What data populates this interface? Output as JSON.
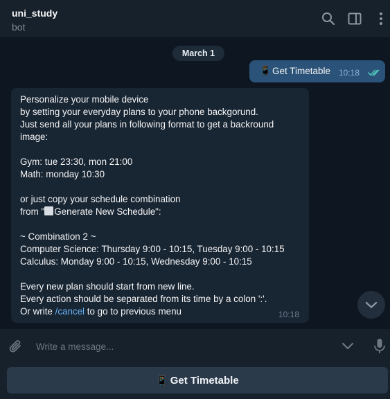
{
  "header": {
    "title": "uni_study",
    "status": "bot",
    "icons": [
      "search-icon",
      "sidebar-toggle-icon",
      "more-vertical-icon"
    ]
  },
  "chat": {
    "date": "March 1",
    "outgoing": {
      "emoji": "📱",
      "text": "Get Timetable",
      "time": "10:18",
      "status_icon": "double-check-icon"
    },
    "incoming": {
      "lines": {
        "l1": "Personalize your mobile device",
        "l2": "by setting your everyday plans to your phone backgorund.",
        "l3": "Just send all your plans in following format to get a backround",
        "l4": "image:",
        "l5": "Gym: tue 23:30, mon 21:00",
        "l6": "Math: monday 10:30",
        "l7": "or just copy your schedule combination",
        "l8a": "from \"",
        "l8b": "Generate New Schedule\":",
        "l9": "~ Combination 2 ~",
        "l10": "Computer Science: Thursday 9:00 - 10:15, Tuesday 9:00 - 10:15",
        "l11": "Calculus: Monday 9:00 - 10:15, Wednesday 9:00 - 10:15",
        "l12": "Every new plan should start from new line.",
        "l13": "Every action should be separated from its time by a colon ':'.",
        "l14a": "Or write ",
        "l14link": "/cancel",
        "l14b": " to go to previous menu"
      },
      "time": "10:18"
    }
  },
  "composer": {
    "placeholder": "Write a message...",
    "value": ""
  },
  "keyboard": {
    "button_emoji": "📱",
    "button_label": "Get Timetable"
  },
  "colors": {
    "background": "#0e1621",
    "header": "#17212b",
    "outgoing_bubble": "#2b5278",
    "incoming_bubble": "#182533",
    "link": "#6ab3f3",
    "check": "#4fc3b8"
  }
}
